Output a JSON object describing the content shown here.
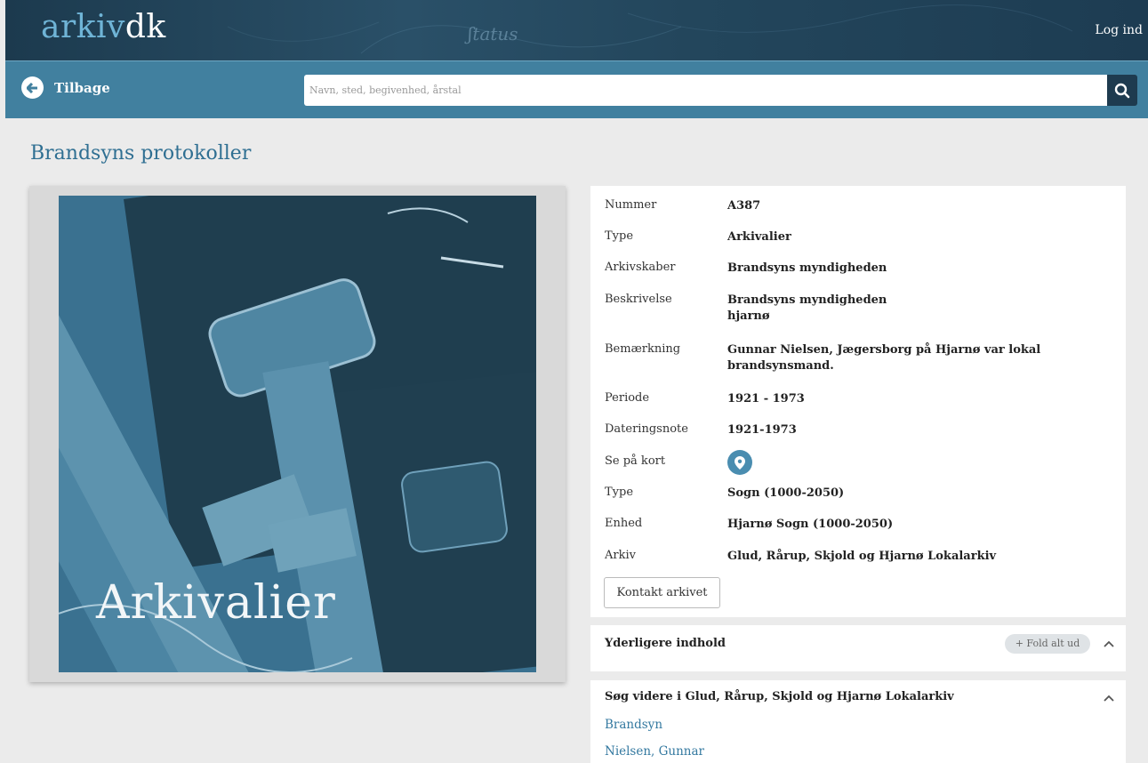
{
  "header": {
    "logo_part1": "arkiv",
    "logo_part2": "dk",
    "login_label": "Log ind"
  },
  "nav": {
    "back_label": "Tilbage",
    "search_placeholder": "Navn, sted, begivenhed, årstal"
  },
  "page": {
    "title": "Brandsyns protokoller",
    "image_label": "Arkivalier"
  },
  "details": {
    "rows": [
      {
        "key": "Nummer",
        "value": "A387"
      },
      {
        "key": "Type",
        "value": "Arkivalier"
      },
      {
        "key": "Arkivskaber",
        "value": "Brandsyns myndigheden"
      },
      {
        "key": "Beskrivelse",
        "value": "Brandsyns myndigheden",
        "value2": "hjarnø"
      },
      {
        "key": "Bemærkning",
        "value": "Gunnar Nielsen, Jægersborg på Hjarnø var lokal",
        "value2": "brandsynsmand."
      },
      {
        "key": "Periode",
        "value": "1921 - 1973"
      },
      {
        "key": "Dateringsnote",
        "value": "1921-1973"
      },
      {
        "key": "Se på kort",
        "value": ""
      },
      {
        "key": "Type",
        "value": "Sogn (1000-2050)"
      },
      {
        "key": "Enhed",
        "value": "Hjarnø Sogn (1000-2050)"
      },
      {
        "key": "Arkiv",
        "value": "Glud, Rårup, Skjold og Hjarnø Lokalarkiv"
      }
    ],
    "contact_label": "Kontakt arkivet"
  },
  "more": {
    "title": "Yderligere indhold",
    "fold_label": "+ Fold alt ud"
  },
  "search_further": {
    "title": "Søg videre i Glud, Rårup, Skjold og Hjarnø Lokalarkiv",
    "links": [
      "Brandsyn",
      "Nielsen, Gunnar"
    ]
  },
  "colors": {
    "accent": "#41809f",
    "header_dark": "#1e3b4f",
    "title_blue": "#2f6f92",
    "link_blue": "#3479a0"
  },
  "icons": {
    "back": "arrow-left-circle-icon",
    "search": "magnifier-icon",
    "map": "map-pin-icon",
    "chevron": "chevron-up-icon"
  }
}
